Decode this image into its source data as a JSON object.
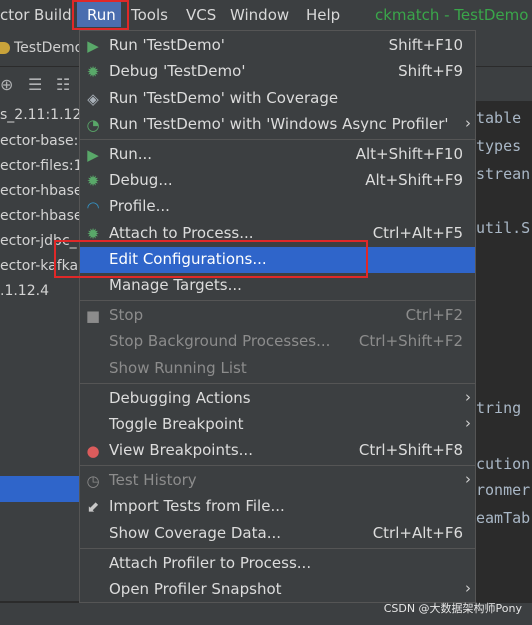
{
  "menubar": {
    "items": [
      "ctor",
      "Build",
      "Run",
      "Tools",
      "VCS",
      "Window",
      "Help"
    ],
    "title": "ckmatch - TestDemo"
  },
  "tab": {
    "label": "TestDemo"
  },
  "left_panel": {
    "items": [
      "s_2.11:1.12",
      "ector-base:",
      "ector-files:1",
      "ector-hbase",
      "ector-hbase",
      "ector-jdbc_",
      "ector-kafka",
      ".1.12.4"
    ]
  },
  "editor": {
    "lines": [
      "table",
      "types",
      "strean",
      "util.S",
      "tring",
      "cution",
      "ronmer",
      "eamTab"
    ]
  },
  "menu": {
    "items": [
      {
        "label": "Run 'TestDemo'",
        "shortcut": "Shift+F10",
        "icon": "run-icon"
      },
      {
        "label": "Debug 'TestDemo'",
        "shortcut": "Shift+F9",
        "icon": "debug-icon"
      },
      {
        "label": "Run 'TestDemo' with Coverage",
        "shortcut": "",
        "icon": "coverage-icon"
      },
      {
        "label": "Run 'TestDemo' with 'Windows Async Profiler'",
        "shortcut": "",
        "icon": "profiler-icon"
      },
      {
        "label": "Run...",
        "shortcut": "Alt+Shift+F10",
        "icon": "run-icon"
      },
      {
        "label": "Debug...",
        "shortcut": "Alt+Shift+F9",
        "icon": "debug-icon"
      },
      {
        "label": "Profile...",
        "shortcut": "",
        "icon": "profile-icon"
      },
      {
        "label": "Attach to Process...",
        "shortcut": "Ctrl+Alt+F5",
        "icon": "attach-icon"
      },
      {
        "label": "Edit Configurations...",
        "shortcut": "",
        "icon": ""
      },
      {
        "label": "Manage Targets...",
        "shortcut": "",
        "icon": ""
      },
      {
        "label": "Stop",
        "shortcut": "Ctrl+F2",
        "icon": "stop-icon"
      },
      {
        "label": "Stop Background Processes...",
        "shortcut": "Ctrl+Shift+F2",
        "icon": ""
      },
      {
        "label": "Show Running List",
        "shortcut": "",
        "icon": ""
      },
      {
        "label": "Debugging Actions",
        "shortcut": "",
        "icon": ""
      },
      {
        "label": "Toggle Breakpoint",
        "shortcut": "",
        "icon": ""
      },
      {
        "label": "View Breakpoints...",
        "shortcut": "Ctrl+Shift+F8",
        "icon": "breakpoints-icon"
      },
      {
        "label": "Test History",
        "shortcut": "",
        "icon": "history-icon"
      },
      {
        "label": "Import Tests from File...",
        "shortcut": "",
        "icon": "import-icon"
      },
      {
        "label": "Show Coverage Data...",
        "shortcut": "Ctrl+Alt+F6",
        "icon": ""
      },
      {
        "label": "Attach Profiler to Process...",
        "shortcut": "",
        "icon": ""
      },
      {
        "label": "Open Profiler Snapshot",
        "shortcut": "",
        "icon": ""
      }
    ]
  },
  "watermark": "CSDN @大数据架构师Pony"
}
